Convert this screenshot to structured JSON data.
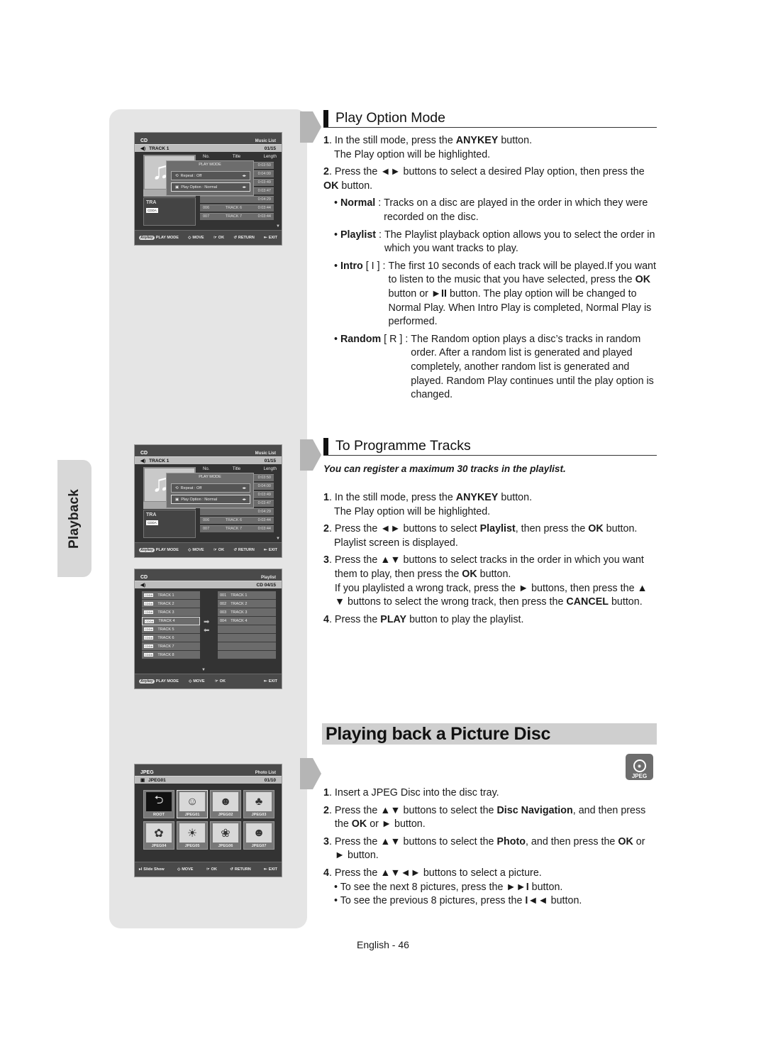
{
  "side_tab": {
    "label": "Playback"
  },
  "sections": {
    "play_option": {
      "title": "Play Option Mode",
      "steps": [
        {
          "num": "1",
          "parts": [
            "In the still mode, press the ",
            "ANYKEY",
            " button."
          ],
          "sub": "The Play option will be highlighted."
        },
        {
          "num": "2",
          "parts": [
            "Press the ◄► buttons to select a desired Play option, then press the ",
            "OK",
            " button."
          ]
        }
      ],
      "bullets": [
        {
          "term": "Normal",
          "suffix": " : ",
          "text": "Tracks on a disc are played in the order in which they were recorded on the disc."
        },
        {
          "term": "Playlist",
          "suffix": " : ",
          "text": "The Playlist playback option allows you to select the order in which you want tracks to play."
        },
        {
          "term": "Intro",
          "suffix": " [ I ] : ",
          "text_a": "The first 10 seconds of each track will be played.If you want to listen to the music that you have selected, press the ",
          "bold_a": "OK",
          "text_b": " button or ",
          "bold_b": "►II",
          "text_c": " button. The play option will be changed to Normal Play. When Intro Play is completed, Normal Play is performed."
        },
        {
          "term": "Random",
          "suffix": " [ R ] : ",
          "text": "The Random option plays a disc’s tracks in random order. After a random list is generated and played completely, another random list is generated and played. Random Play continues until the play option is changed."
        }
      ]
    },
    "programme": {
      "title": "To Programme Tracks",
      "note": "You can register a maximum 30 tracks in the playlist.",
      "step1": {
        "num": "1",
        "a": "In the still mode, press the ",
        "b": "ANYKEY",
        "c": " button.",
        "sub": "The Play option will be highlighted."
      },
      "step2": {
        "num": "2",
        "a": "Press the ◄► buttons to select ",
        "b": "Playlist",
        "c": ", then press the ",
        "d": "OK",
        "e": " button.",
        "sub": "Playlist screen is displayed."
      },
      "step3": {
        "num": "3",
        "a": "Press the ▲▼ buttons to select tracks in the order in which you want them to play, then press the ",
        "b": "OK",
        "c": " button.",
        "sub_a": "If you playlisted a wrong track, press the ► buttons, then press the ▲ ▼ buttons to select the wrong track, then press the ",
        "sub_b": "CANCEL",
        "sub_c": " button."
      },
      "step4": {
        "num": "4",
        "a": "Press the ",
        "b": "PLAY",
        "c": " button to play the playlist."
      }
    },
    "picture": {
      "title": "Playing back a Picture Disc",
      "icon_label": "JPEG",
      "step1": {
        "num": "1",
        "a": "Insert a JPEG Disc into the disc tray."
      },
      "step2": {
        "num": "2",
        "a": "Press the ▲▼ buttons to select the ",
        "b": "Disc Navigation",
        "c": ", and then press the ",
        "d": "OK",
        "e": " or ► button."
      },
      "step3": {
        "num": "3",
        "a": "Press the ▲▼ buttons to select the ",
        "b": "Photo",
        "c": ", and then press the ",
        "d": "OK",
        "e": " or ► button."
      },
      "step4": {
        "num": "4",
        "a": "Press the ▲▼◄► buttons to select a picture."
      },
      "sub_bullets": [
        {
          "a": "To see the next 8 pictures, press the ",
          "b": "►►I",
          "c": " button."
        },
        {
          "a": "To see the previous 8 pictures, press the ",
          "b": "I◄◄",
          "c": " button."
        }
      ]
    }
  },
  "screens": {
    "music": {
      "left": "CD",
      "right": "Music List",
      "track": "TRACK 1",
      "count": "01/15",
      "art_time": "0:0",
      "info_title": "TRA",
      "cdda": "CDDA",
      "head": [
        "No.",
        "Title",
        "Length"
      ],
      "rows": [
        {
          "no": "",
          "title": "",
          "len": "0:03:50"
        },
        {
          "no": "",
          "title": "",
          "len": "0:04:00"
        },
        {
          "no": "",
          "title": "",
          "len": "0:03:49"
        },
        {
          "no": "",
          "title": "",
          "len": "0:03:47"
        },
        {
          "no": "",
          "title": "",
          "len": "0:04:29"
        },
        {
          "no": "006",
          "title": "TRACK 6",
          "len": "0:03:44"
        },
        {
          "no": "007",
          "title": "TRACK 7",
          "len": "0:03:44"
        }
      ],
      "popup": {
        "title": "PLAY MODE",
        "repeat": "Repeat : Off",
        "option": "Play Option : Normal"
      },
      "footer": {
        "anykey": "Anykey",
        "mode": "PLAY MODE",
        "move": "MOVE",
        "ok": "OK",
        "ret": "RETURN",
        "exit": "EXIT"
      }
    },
    "playlist": {
      "left": "CD",
      "right": "Playlist",
      "count": "CD 04/15",
      "tracks": [
        "TRACK 1",
        "TRACK 2",
        "TRACK 3",
        "TRACK 4",
        "TRACK 5",
        "TRACK 6",
        "TRACK 7",
        "TRACK 8"
      ],
      "cdda": "CDDA",
      "selected": [
        {
          "no": "001",
          "title": "TRACK 1"
        },
        {
          "no": "002",
          "title": "TRACK 2"
        },
        {
          "no": "003",
          "title": "TRACK 3"
        },
        {
          "no": "004",
          "title": "TRACK 4"
        }
      ],
      "footer": {
        "anykey": "Anykey",
        "mode": "PLAY MODE",
        "move": "MOVE",
        "ok": "OK",
        "exit": "EXIT"
      }
    },
    "photo": {
      "left": "JPEG",
      "right": "Photo List",
      "item": "JPEG01",
      "count": "01/10",
      "thumbs": [
        "ROOT",
        "JPEG01",
        "JPEG02",
        "JPEG03",
        "JPEG04",
        "JPEG05",
        "JPEG06",
        "JPEG07"
      ],
      "footer": {
        "slide": "Slide Show",
        "move": "MOVE",
        "ok": "OK",
        "ret": "RETURN",
        "exit": "EXIT"
      }
    }
  },
  "footer": {
    "page": "English - 46"
  }
}
